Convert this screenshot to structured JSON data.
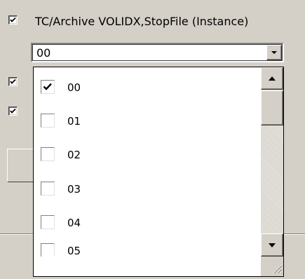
{
  "header": {
    "option_label": "TC/Archive VOLIDX,StopFile (Instance)",
    "option_checked": true
  },
  "combo": {
    "selected_value": "00",
    "arrow_icon": "dropdown-arrow-icon"
  },
  "background_options": [
    {
      "checked": true
    },
    {
      "checked": true
    }
  ],
  "popup": {
    "items": [
      {
        "label": "00",
        "checked": true
      },
      {
        "label": "01",
        "checked": false
      },
      {
        "label": "02",
        "checked": false
      },
      {
        "label": "03",
        "checked": false
      },
      {
        "label": "04",
        "checked": false
      },
      {
        "label": "05",
        "checked": false
      }
    ],
    "scroll_up_icon": "scroll-up-arrow-icon",
    "scroll_down_icon": "scroll-down-arrow-icon",
    "resize_icon": "resize-grip-icon"
  }
}
